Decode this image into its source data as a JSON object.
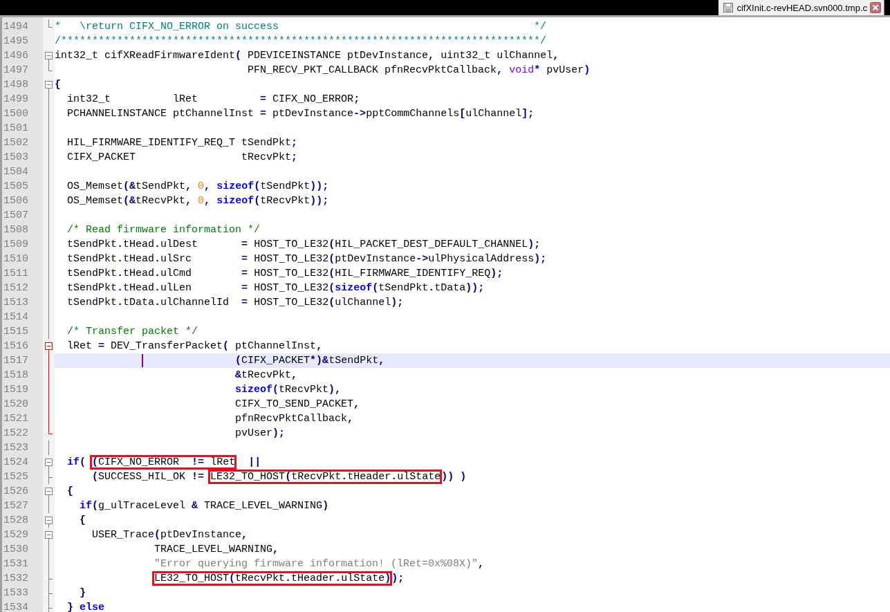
{
  "tab": {
    "title": "cifXInit.c-revHEAD.svn000.tmp.c"
  },
  "lines": [
    {
      "number": "1494",
      "fold": {
        "kind": "end",
        "current": false
      },
      "current": false,
      "segments": [
        {
          "text": "*   \\return CIFX_NO_ERROR on success                                         */",
          "kind": "doc_comment"
        }
      ]
    },
    {
      "number": "1495",
      "current": false,
      "segments": [
        {
          "text": "/*****************************************************************************/",
          "kind": "doc_comment"
        }
      ]
    },
    {
      "number": "1496",
      "fold": {
        "kind": "open",
        "current": false
      },
      "current": false,
      "segments": [
        {
          "text": "int32_t cifXReadFirmwareIdent( PDEVICEINSTANCE ptDevInstance, uint32_t ulChannel,",
          "kind": "plain"
        }
      ]
    },
    {
      "number": "1497",
      "fold": {
        "kind": "end",
        "current": false
      },
      "current": false,
      "segments": [
        {
          "text": "                               PFN_RECV_PKT_CALLBACK pfnRecvPktCallback, ",
          "kind": "plain"
        },
        {
          "text": "void",
          "kind": "type"
        },
        {
          "text": "* pvUser)",
          "kind": "plain"
        }
      ]
    },
    {
      "number": "1498",
      "fold": {
        "kind": "open",
        "current": false
      },
      "current": false,
      "segments": [
        {
          "text": "{",
          "kind": "plain"
        }
      ]
    },
    {
      "number": "1499",
      "fold": {
        "kind": "line",
        "current": false
      },
      "current": false,
      "segments": [
        {
          "text": "  int32_t",
          "kind": "plain"
        },
        {
          "text": "          lRet",
          "kind": "plain"
        },
        {
          "text": "          = CIFX_NO_ERROR;",
          "kind": "plain"
        }
      ]
    },
    {
      "number": "1500",
      "fold": {
        "kind": "line",
        "current": false
      },
      "current": false,
      "segments": [
        {
          "text": "  PCHANNELINSTANCE ptChannelInst = ptDevInstance->pptCommChannels[ulChannel];",
          "kind": "plain"
        }
      ]
    },
    {
      "number": "1501",
      "fold": {
        "kind": "line",
        "current": false
      },
      "current": false
    },
    {
      "number": "1502",
      "fold": {
        "kind": "line",
        "current": false
      },
      "current": false,
      "segments": [
        {
          "text": "  HIL_FIRMWARE_IDENTIFY_REQ_T tSendPkt;",
          "kind": "plain"
        }
      ]
    },
    {
      "number": "1503",
      "fold": {
        "kind": "line",
        "current": false
      },
      "current": false,
      "segments": [
        {
          "text": "  CIFX_PACKET                 tRecvPkt;",
          "kind": "plain"
        }
      ]
    },
    {
      "number": "1504",
      "fold": {
        "kind": "line",
        "current": false
      },
      "current": false
    },
    {
      "number": "1505",
      "fold": {
        "kind": "line",
        "current": false
      },
      "current": false,
      "segments": [
        {
          "text": "  OS_Memset(&tSendPkt, ",
          "kind": "plain"
        },
        {
          "text": "0",
          "kind": "number"
        },
        {
          "text": ", ",
          "kind": "plain"
        },
        {
          "text": "sizeof",
          "kind": "keyword"
        },
        {
          "text": "(tSendPkt));",
          "kind": "plain"
        }
      ]
    },
    {
      "number": "1506",
      "fold": {
        "kind": "line",
        "current": false
      },
      "current": false,
      "segments": [
        {
          "text": "  OS_Memset(&tRecvPkt, ",
          "kind": "plain"
        },
        {
          "text": "0",
          "kind": "number"
        },
        {
          "text": ", ",
          "kind": "plain"
        },
        {
          "text": "sizeof",
          "kind": "keyword"
        },
        {
          "text": "(tRecvPkt));",
          "kind": "plain"
        }
      ]
    },
    {
      "number": "1507",
      "fold": {
        "kind": "line",
        "current": false
      },
      "current": false
    },
    {
      "number": "1508",
      "fold": {
        "kind": "line",
        "current": false
      },
      "current": false,
      "segments": [
        {
          "text": "  /* Read firmware information */",
          "kind": "comment"
        }
      ]
    },
    {
      "number": "1509",
      "fold": {
        "kind": "line",
        "current": false
      },
      "current": false,
      "segments": [
        {
          "text": "  tSendPkt.tHead.ulDest       = HOST_TO_LE32(HIL_PACKET_DEST_DEFAULT_CHANNEL);",
          "kind": "plain"
        }
      ]
    },
    {
      "number": "1510",
      "fold": {
        "kind": "line",
        "current": false
      },
      "current": false,
      "segments": [
        {
          "text": "  tSendPkt.tHead.ulSrc        = HOST_TO_LE32(ptDevInstance->ulPhysicalAddress);",
          "kind": "plain"
        }
      ]
    },
    {
      "number": "1511",
      "fold": {
        "kind": "line",
        "current": false
      },
      "current": false,
      "segments": [
        {
          "text": "  tSendPkt.tHead.ulCmd        = HOST_TO_LE32(HIL_FIRMWARE_IDENTIFY_REQ);",
          "kind": "plain"
        }
      ]
    },
    {
      "number": "1512",
      "fold": {
        "kind": "line",
        "current": false
      },
      "current": false,
      "segments": [
        {
          "text": "  tSendPkt.tHead.ulLen        = HOST_TO_LE32(",
          "kind": "plain"
        },
        {
          "text": "sizeof",
          "kind": "keyword"
        },
        {
          "text": "(tSendPkt.tData));",
          "kind": "plain"
        }
      ]
    },
    {
      "number": "1513",
      "fold": {
        "kind": "line",
        "current": false
      },
      "current": false,
      "segments": [
        {
          "text": "  tSendPkt.tData.ulChannelId  = HOST_TO_LE32(ulChannel);",
          "kind": "plain"
        }
      ]
    },
    {
      "number": "1514",
      "fold": {
        "kind": "line",
        "current": false
      },
      "current": false
    },
    {
      "number": "1515",
      "fold": {
        "kind": "line",
        "current": false
      },
      "current": false,
      "segments": [
        {
          "text": "  /* Transfer packet */",
          "kind": "comment"
        }
      ]
    },
    {
      "number": "1516",
      "fold": {
        "kind": "open",
        "current": true
      },
      "current": false,
      "segments": [
        {
          "text": "  lRet = DEV_TransferPacket( ptChannelInst,",
          "kind": "plain"
        }
      ]
    },
    {
      "number": "1517",
      "fold": {
        "kind": "line",
        "current": true
      },
      "current": true,
      "segments": [
        {
          "text": "                             (CIFX_PACKET*)&tSendPkt,",
          "kind": "plain",
          "caret": true
        }
      ]
    },
    {
      "number": "1518",
      "fold": {
        "kind": "line",
        "current": true
      },
      "current": false,
      "segments": [
        {
          "text": "                             &tRecvPkt,",
          "kind": "plain"
        }
      ]
    },
    {
      "number": "1519",
      "fold": {
        "kind": "line",
        "current": true
      },
      "current": false,
      "segments": [
        {
          "text": "                             sizeof",
          "kind": "keyword"
        },
        {
          "text": "(tRecvPkt),",
          "kind": "plain"
        }
      ]
    },
    {
      "number": "1520",
      "fold": {
        "kind": "line",
        "current": true
      },
      "current": false,
      "segments": [
        {
          "text": "                             CIFX_TO_SEND_PACKET,",
          "kind": "plain"
        }
      ]
    },
    {
      "number": "1521",
      "fold": {
        "kind": "line",
        "current": true
      },
      "current": false,
      "segments": [
        {
          "text": "                             pfnRecvPktCallback,",
          "kind": "plain"
        }
      ]
    },
    {
      "number": "1522",
      "fold": {
        "kind": "end",
        "current": true
      },
      "current": false,
      "segments": [
        {
          "text": "                             pvUser);",
          "kind": "plain"
        }
      ]
    },
    {
      "number": "1523",
      "fold": {
        "kind": "line",
        "current": false
      },
      "current": false
    },
    {
      "number": "1524",
      "fold": {
        "kind": "open",
        "current": false
      },
      "current": false,
      "segments": [
        {
          "text": "  if",
          "kind": "keyword"
        },
        {
          "text": "( ",
          "kind": "plain"
        },
        {
          "text": "(CIFX_NO_ERROR  != lRet",
          "kind": "box"
        },
        {
          "text": "  ||",
          "kind": "plain"
        }
      ]
    },
    {
      "number": "1525",
      "fold": {
        "kind": "tee",
        "current": false
      },
      "current": false,
      "segments": [
        {
          "text": "      (SUCCESS_HIL_OK != ",
          "kind": "plain"
        },
        {
          "text": "LE32_TO_HOST(tRecvPkt.tHeader.ulState",
          "kind": "box"
        },
        {
          "text": ")) )",
          "kind": "plain"
        }
      ]
    },
    {
      "number": "1526",
      "fold": {
        "kind": "open",
        "current": false
      },
      "current": false,
      "segments": [
        {
          "text": "  {",
          "kind": "plain"
        }
      ]
    },
    {
      "number": "1527",
      "fold": {
        "kind": "line",
        "current": false
      },
      "current": false,
      "segments": [
        {
          "text": "    if",
          "kind": "keyword"
        },
        {
          "text": "(g_ulTraceLevel & TRACE_LEVEL_WARNING)",
          "kind": "plain"
        }
      ]
    },
    {
      "number": "1528",
      "fold": {
        "kind": "open",
        "current": false
      },
      "current": false,
      "segments": [
        {
          "text": "    {",
          "kind": "plain"
        }
      ]
    },
    {
      "number": "1529",
      "fold": {
        "kind": "open",
        "current": false
      },
      "current": false,
      "segments": [
        {
          "text": "      USER_Trace(ptDevInstance,",
          "kind": "plain"
        }
      ]
    },
    {
      "number": "1530",
      "fold": {
        "kind": "line",
        "current": false
      },
      "current": false,
      "segments": [
        {
          "text": "                TRACE_LEVEL_WARNING,",
          "kind": "plain"
        }
      ]
    },
    {
      "number": "1531",
      "fold": {
        "kind": "line",
        "current": false
      },
      "current": false,
      "segments": [
        {
          "text": "                \"Error querying firmware information! (lRet=0x%08X)\"",
          "kind": "string"
        },
        {
          "text": ",",
          "kind": "plain"
        }
      ]
    },
    {
      "number": "1532",
      "fold": {
        "kind": "tee",
        "current": false
      },
      "current": false,
      "segments": [
        {
          "text": "                LE32_TO_HOST(tRecvPkt.tHeader.ulState)",
          "kind": "box"
        },
        {
          "text": ");",
          "kind": "plain"
        }
      ]
    },
    {
      "number": "1533",
      "fold": {
        "kind": "tee",
        "current": false
      },
      "current": false,
      "segments": [
        {
          "text": "    }",
          "kind": "plain"
        }
      ]
    },
    {
      "number": "1534",
      "fold": {
        "kind": "tee",
        "current": false
      },
      "current": false,
      "segments": [
        {
          "text": "  } ",
          "kind": "plain"
        },
        {
          "text": "else",
          "kind": "keyword"
        }
      ]
    }
  ]
}
